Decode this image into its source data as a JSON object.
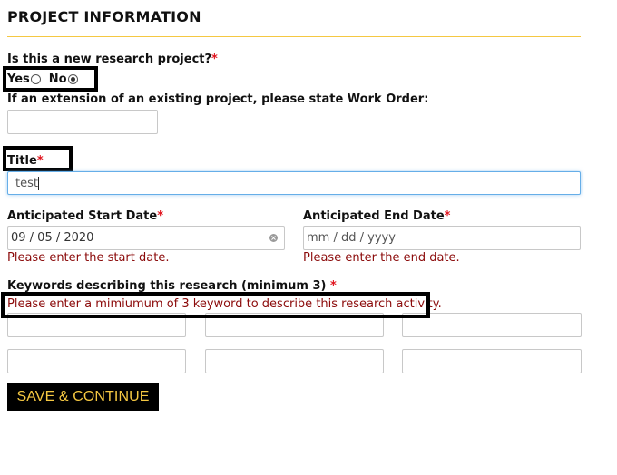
{
  "section": {
    "title": "PROJECT INFORMATION"
  },
  "new_project": {
    "question": "Is this a new research project?",
    "required_mark": "*",
    "options": [
      {
        "label": "Yes",
        "checked": false
      },
      {
        "label": "No",
        "checked": true
      }
    ]
  },
  "work_order": {
    "label": "If an extension of an existing project, please state Work Order:",
    "value": ""
  },
  "title_field": {
    "label": "Title",
    "required_mark": "*",
    "value": "test"
  },
  "start_date": {
    "label": "Anticipated Start Date",
    "required_mark": "*",
    "value": "09 / 05 / 2020",
    "clear_icon": "clear-icon",
    "error": "Please enter the start date."
  },
  "end_date": {
    "label": "Anticipated End Date",
    "required_mark": "*",
    "placeholder": "mm / dd / yyyy",
    "error": "Please enter the end date."
  },
  "keywords": {
    "label": "Keywords describing this research (minimum 3)",
    "required_mark": "*",
    "error": "Please enter a mimiumum of 3 keyword to describe this research activity.",
    "values": [
      "",
      "",
      "",
      "",
      "",
      ""
    ]
  },
  "actions": {
    "save_label": "SAVE & CONTINUE"
  },
  "colors": {
    "accent": "#f5c842",
    "required": "#e0141e",
    "error": "#8b0a0a",
    "button_bg": "#000000",
    "focus": "#66aee8"
  }
}
